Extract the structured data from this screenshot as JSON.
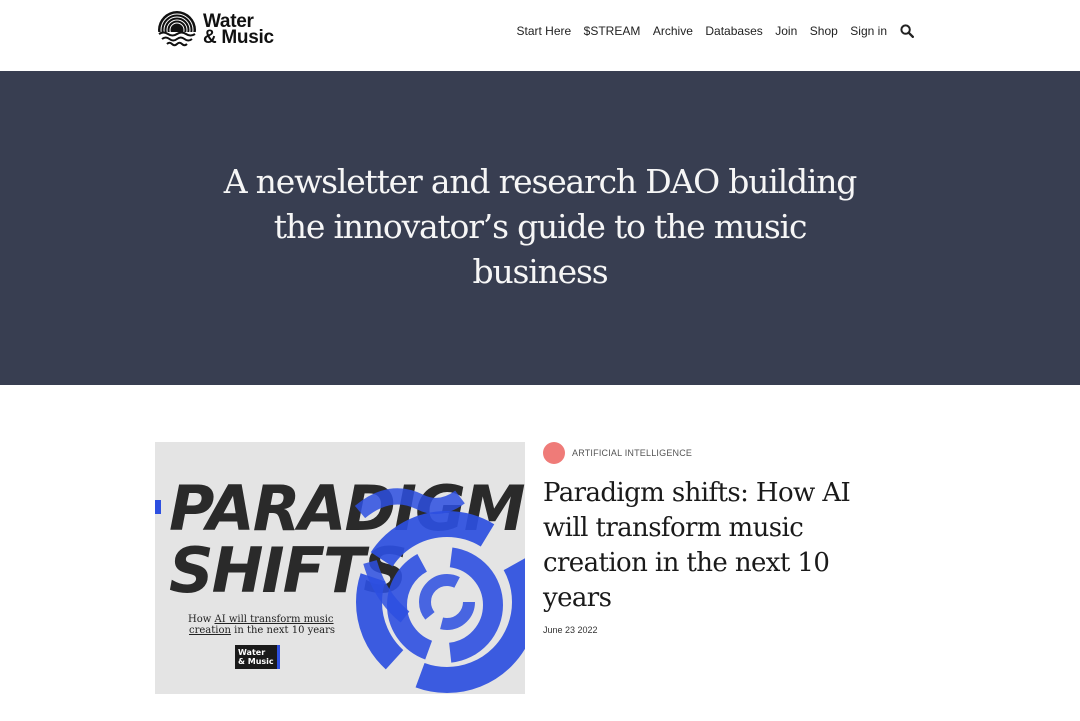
{
  "header": {
    "logo": {
      "line1": "Water",
      "line2": "& Music"
    },
    "nav": [
      "Start Here",
      "$STREAM",
      "Archive",
      "Databases",
      "Join",
      "Shop",
      "Sign in"
    ],
    "search_icon": "search-icon"
  },
  "hero": {
    "headline": "A newsletter and research DAO building the innovator’s guide to the music business",
    "background": "#383e51"
  },
  "featured_post": {
    "tag": "ARTIFICIAL INTELLIGENCE",
    "tag_color": "#ef7b78",
    "title": "Paradigm shifts: How AI will transform music creation in the next 10 years",
    "date": "June 23 2022",
    "image": {
      "big_line1": "PARADIGM",
      "big_line2": "SHIFTS",
      "caption_pre": "How ",
      "caption_link1": "AI will transform music",
      "caption_link2": "creation",
      "caption_post": " in the next 10 years",
      "badge_line1": "Water",
      "badge_line2": "& Music",
      "accent": "#2d4fe0"
    }
  }
}
